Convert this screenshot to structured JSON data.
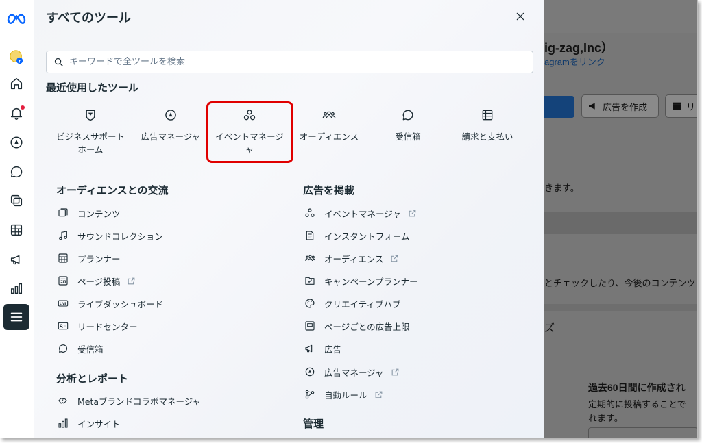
{
  "panel": {
    "title": "すべてのツール",
    "search_placeholder": "キーワードで全ツールを検索",
    "recent_heading": "最近使用したツール",
    "recent": [
      {
        "label": "ビジネスサポート\nホーム",
        "icon": "shield-icon"
      },
      {
        "label": "広告マネージャ",
        "icon": "compass-icon"
      },
      {
        "label": "イベントマネージ\nャ",
        "icon": "event-nodes-icon"
      },
      {
        "label": "オーディエンス",
        "icon": "people-group-icon"
      },
      {
        "label": "受信箱",
        "icon": "chat-bubble-icon"
      },
      {
        "label": "請求と支払い",
        "icon": "billing-icon"
      }
    ],
    "sections": {
      "audience": {
        "heading": "オーディエンスとの交流",
        "items": [
          "コンテンツ",
          "サウンドコレクション",
          "プランナー",
          "ページ投稿",
          "ライブダッシュボード",
          "リードセンター",
          "受信箱"
        ]
      },
      "analytics": {
        "heading": "分析とレポート",
        "items": [
          "Metaブランドコラボマネージャ",
          "インサイト"
        ]
      },
      "ads": {
        "heading": "広告を掲載",
        "items": [
          "イベントマネージャ",
          "インスタントフォーム",
          "オーディエンス",
          "キャンペーンプランナー",
          "クリエイティブハブ",
          "ページごとの広告上限",
          "広告",
          "広告マネージャ",
          "自動ルール"
        ]
      },
      "manage": {
        "heading": "管理"
      }
    }
  },
  "background": {
    "account_name": "ig-zag,Inc）",
    "instagram_link": "agramをリンク",
    "create_ad_button": "広告を作成",
    "second_button": "リ",
    "text_1": "きます。",
    "text_2": "とチェックしたり、今後のコンテンツ",
    "text_3": "ズ",
    "card_title": "過去60日間に作成され",
    "card_line_1": "定期的に投稿することで",
    "card_line_2": "れます。"
  },
  "colors": {
    "highlight": "#e00000",
    "meta_blue": "#0866ff",
    "text": "#1c2b33",
    "dim_overlay": "#777777"
  }
}
